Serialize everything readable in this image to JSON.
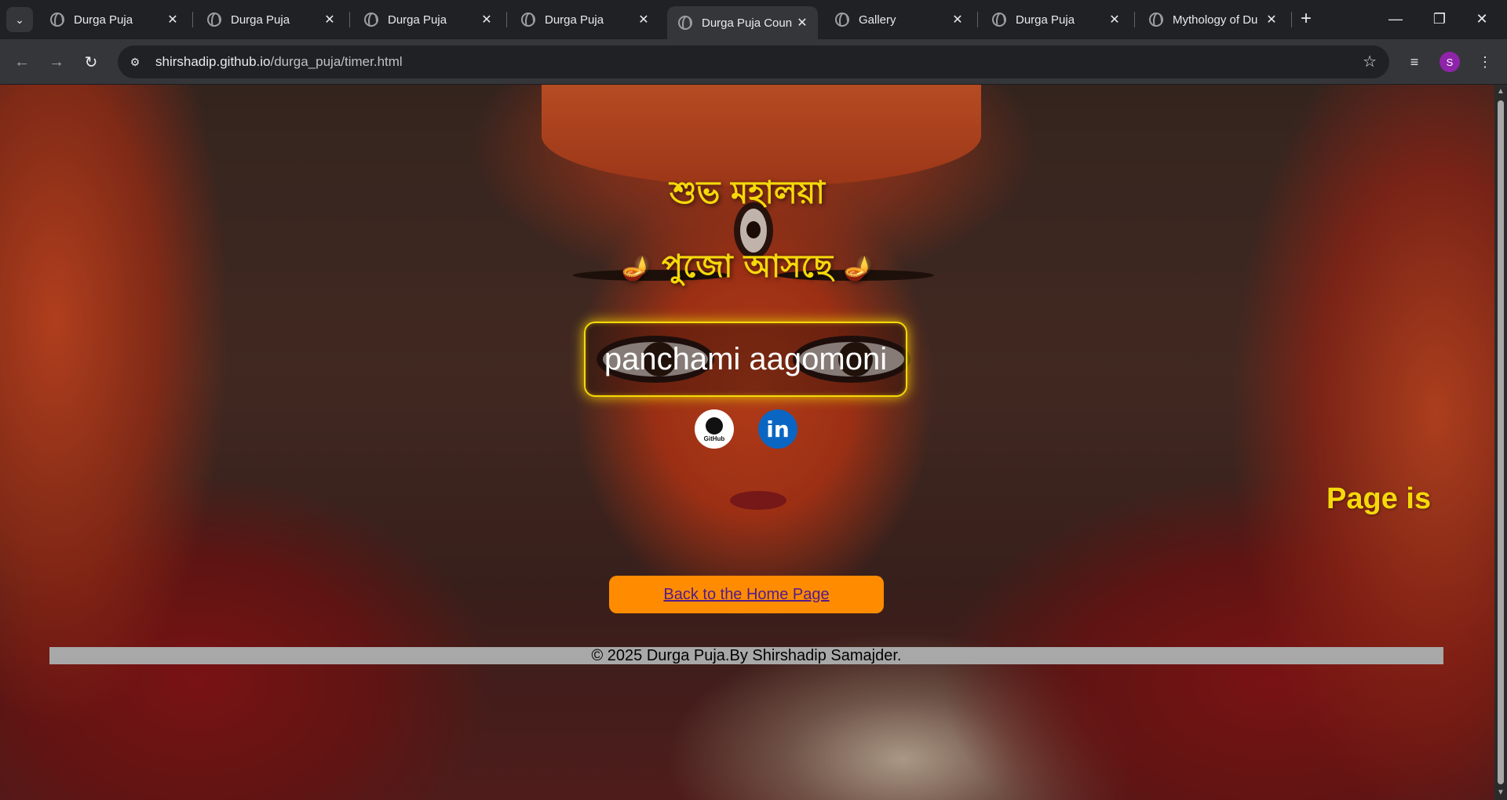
{
  "browser": {
    "tabs": [
      {
        "title": "Durga Puja",
        "active": false
      },
      {
        "title": "Durga Puja",
        "active": false
      },
      {
        "title": "Durga Puja",
        "active": false
      },
      {
        "title": "Durga Puja",
        "active": false
      },
      {
        "title": "Durga Puja Coun",
        "active": true
      },
      {
        "title": "Gallery",
        "active": false
      },
      {
        "title": "Durga Puja",
        "active": false
      },
      {
        "title": "Mythology of Du",
        "active": false
      }
    ],
    "url_host": "shirshadip.github.io",
    "url_path": "/durga_puja/timer.html",
    "profile_initial": "S"
  },
  "page": {
    "greeting": "শুভ মহালয়া",
    "coming": "পুজো আসছে",
    "diya_glyph": "🪔",
    "timer_text": "panchami aagomoni",
    "github_label": "GitHub",
    "linkedin_label": "in",
    "marquee_text": "Page is",
    "home_button": "Back to the Home Page",
    "footer": "© 2025 Durga Puja.By Shirshadip Samajder."
  },
  "colors": {
    "heading": "#f5d90a",
    "button": "#ff8c00",
    "link": "#551a8b",
    "footer_bg": "#a8a8a8"
  }
}
